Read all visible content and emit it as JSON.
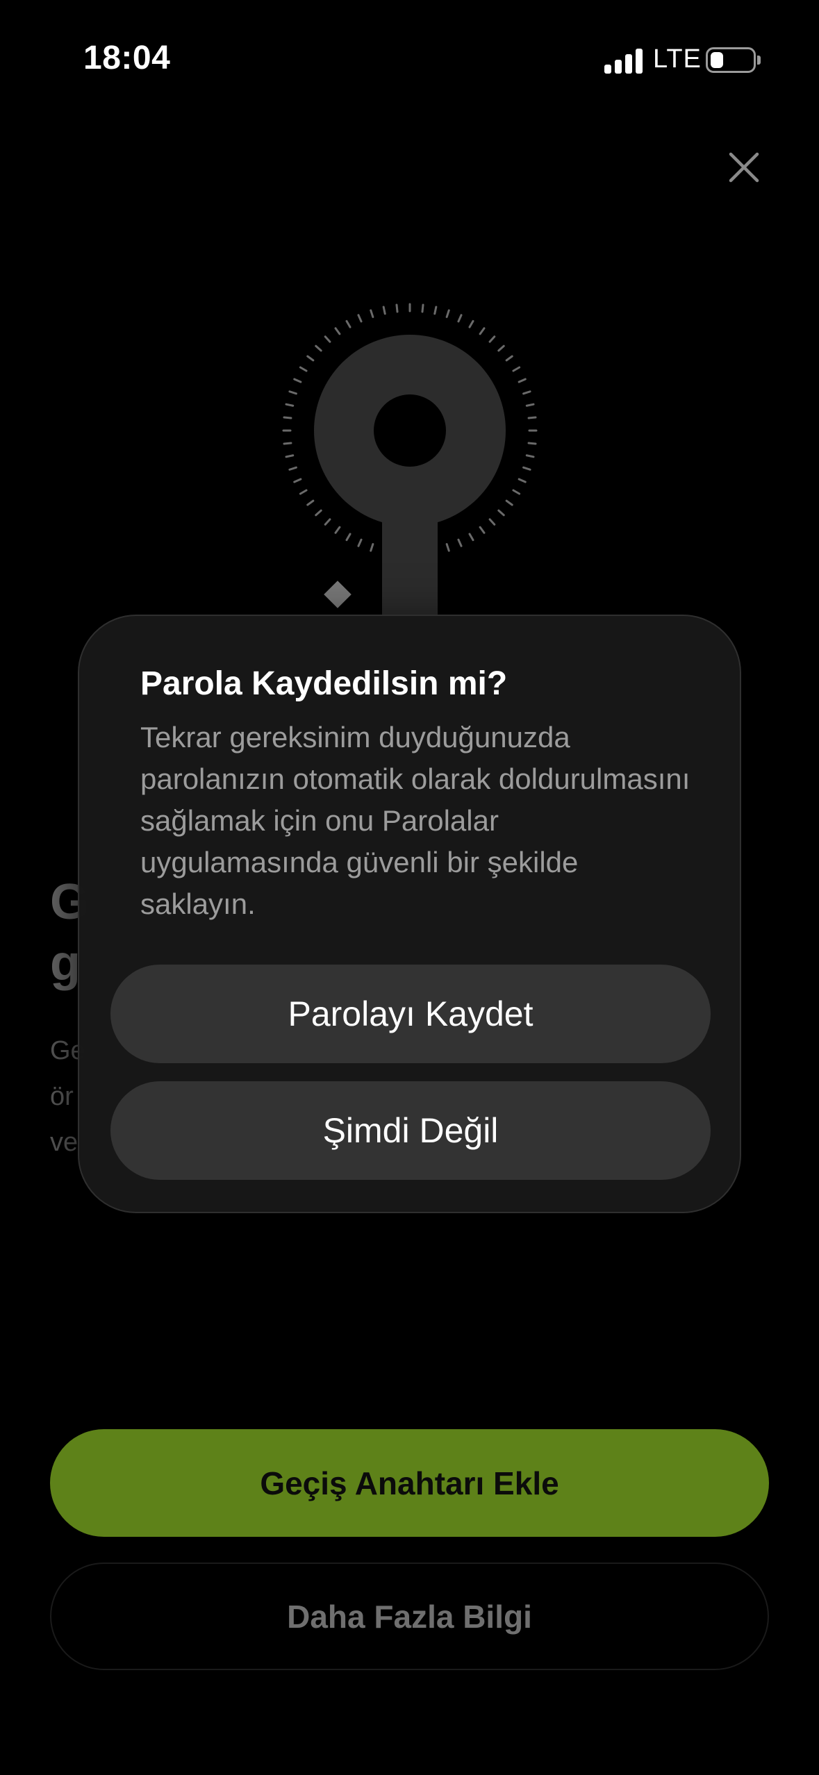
{
  "status_bar": {
    "time": "18:04",
    "network": "LTE",
    "icons": [
      "signal-icon",
      "battery-icon"
    ]
  },
  "close": {
    "icon": "close-icon"
  },
  "illustration": {
    "icon": "passkey-key-icon"
  },
  "background": {
    "headline_line1": "G",
    "headline_line2": "g",
    "body_line1": "Ge",
    "body_line2": "ör",
    "body_line3": "ve"
  },
  "dialog": {
    "title": "Parola Kaydedilsin mi?",
    "message": "Tekrar gereksinim duyduğunuzda parolanızın otomatik olarak doldurulmasını sağlamak için onu Parolalar uygulamasında güvenli bir şekilde saklayın.",
    "save_label": "Parolayı Kaydet",
    "not_now_label": "Şimdi Değil"
  },
  "actions": {
    "primary_label": "Geçiş Anahtarı Ekle",
    "secondary_label": "Daha Fazla Bilgi"
  },
  "colors": {
    "accent": "#5e8219",
    "background": "#000000",
    "dialog": "#181818",
    "dialog_button": "#333333"
  }
}
